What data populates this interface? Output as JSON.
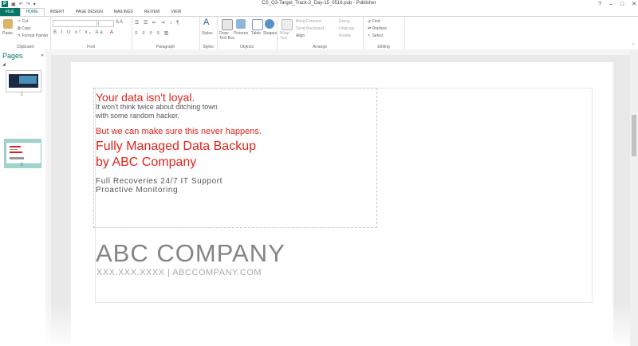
{
  "window": {
    "title": "CS_Q3-Target_Track-2_Day-15_0516.pub - Publisher",
    "app_icon_letter": "P",
    "controls": [
      "?",
      "–",
      "□",
      "✕"
    ]
  },
  "tabs": [
    "FILE",
    "HOME",
    "INSERT",
    "PAGE DESIGN",
    "MAILINGS",
    "REVIEW",
    "VIEW"
  ],
  "ribbon": {
    "clipboard": {
      "paste": "Paste",
      "cut": "Cut",
      "copy": "Copy",
      "format_painter": "Format Painter",
      "label": "Clipboard"
    },
    "font": {
      "label": "Font"
    },
    "paragraph": {
      "label": "Paragraph"
    },
    "styles": {
      "styles": "Styles",
      "label": "Styles"
    },
    "objects": {
      "draw_text_box": "Draw Text Box",
      "pictures": "Pictures",
      "table": "Table",
      "shapes": "Shapes",
      "label": "Objects"
    },
    "arrange": {
      "wrap_text": "Wrap Text",
      "bring_forward": "Bring Forward",
      "send_backward": "Send Backward",
      "align": "Align",
      "group": "Group",
      "ungroup": "Ungroup",
      "rotate": "Rotate",
      "label": "Arrange"
    },
    "editing": {
      "find": "Find",
      "replace": "Replace",
      "select": "Select",
      "label": "Editing"
    }
  },
  "pages_pane": {
    "title": "Pages",
    "page_numbers": [
      "1",
      "2"
    ]
  },
  "document": {
    "headline": "Your data isn't loyal.",
    "body_line1": "It won't think twice about ditching town",
    "body_line2": "with some random hacker.",
    "promise": "But we can make sure this never happens.",
    "service_line1": "Fully Managed Data Backup",
    "service_line2": "by ABC Company",
    "feature_line1": "Full Recoveries  24/7 IT Support",
    "feature_line2": "Proactive Monitoring",
    "company_name": "ABC COMPANY",
    "contact": "XXX.XXX.XXXX  |  ABCCOMPANY.COM"
  },
  "colors": {
    "brand_teal": "#077568",
    "headline_red": "#e2231a",
    "company_gray": "#858585"
  }
}
